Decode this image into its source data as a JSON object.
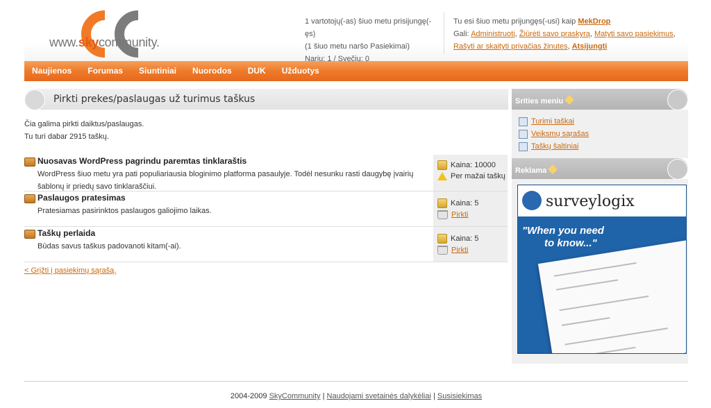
{
  "header": {
    "logo_prefix": "www.",
    "logo_sky": "sky",
    "logo_suffix": "community.",
    "stats_line1": "1 vartotojų(-as) šiuo metu prisijungę(-ęs)",
    "stats_line2": "(1 šiuo metu naršo Pasiekimai)",
    "stats_line3": "Narių: 1 / Svečių: 0",
    "user_prefix": "Tu esi šiuo metu prijungęs(-usi) kaip",
    "username": "MekDrop",
    "can_label": "Gali:",
    "links": [
      "Administruoti",
      "Žiūrėti savo praskyrą",
      "Matyti savo pasiekimus",
      "Rašyti ar skaityti privačias žinutes",
      "Atsijungti"
    ]
  },
  "nav": [
    "Naujienos",
    "Forumas",
    "Siuntiniai",
    "Nuorodos",
    "DUK",
    "Užduotys"
  ],
  "main": {
    "title": "Pirkti prekes/paslaugas už turimus taškus",
    "intro1": "Čia galima pirkti daiktus/paslaugas.",
    "intro2": "Tu turi dabar 2915 taškų.",
    "items": [
      {
        "title": "Nuosavas WordPress pagrindu paremtas tinklaraštis",
        "desc": "WordPress šiuo metu yra pati populiariausia bloginimo platforma pasaulyje. Todėl nesunku rasti daugybę įvairių šablonų ir priedų savo tinklaraščiui.",
        "price": "Kaina: 10000",
        "status": "Per mažai taškų"
      },
      {
        "title": "Paslaugos pratesimas",
        "desc": "Pratesiamas pasirinktos paslaugos galiojimo laikas.",
        "price": "Kaina: 5",
        "status": "Pirkti"
      },
      {
        "title": "Taškų perlaida",
        "desc": "Būdas savus taškus padovanoti kitam(-ai).",
        "price": "Kaina: 5",
        "status": "Pirkti"
      }
    ],
    "back": "< Grįžti į pasiekimų sąrašą."
  },
  "sidebar": {
    "menu_title": "Srities meniu",
    "menu_items": [
      "Turimi taškai",
      "Veiksmų sąrašas",
      "Taškų šaltiniai"
    ],
    "ad_title": "Reklama",
    "ad_brand": "surveylogix",
    "ad_tagline1": "\"When you need",
    "ad_tagline2": "to know...\""
  },
  "footer": {
    "year": "2004-2009",
    "site": "SkyCommunity",
    "terms": "Naudojami svetainės dalykėliai",
    "contact": "Susisiekimas"
  }
}
